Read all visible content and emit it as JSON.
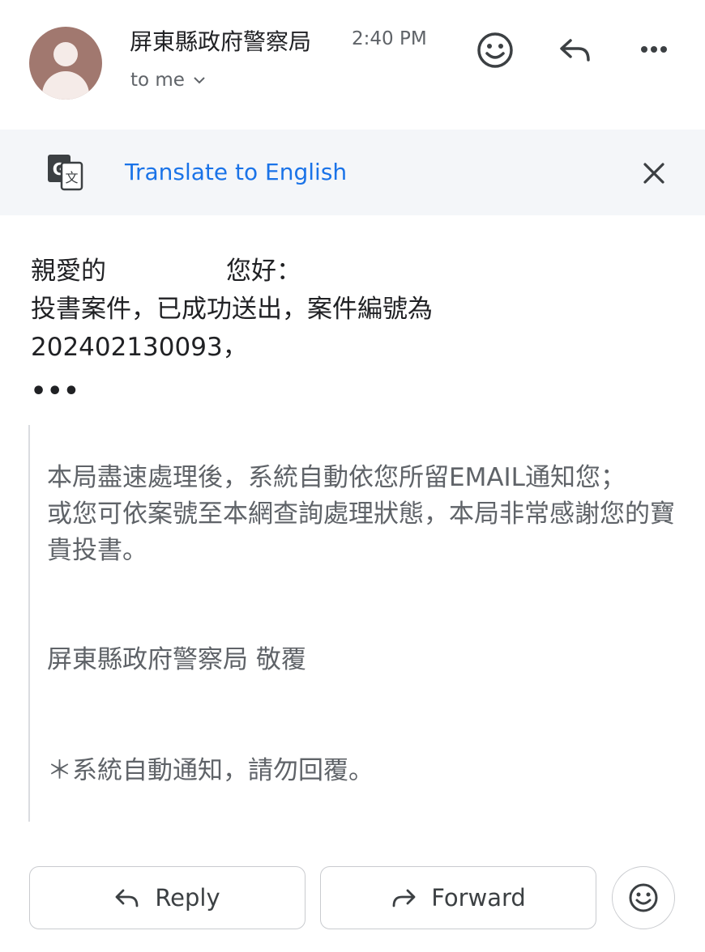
{
  "header": {
    "sender": "屏東縣政府警察局",
    "time": "2:40 PM",
    "recipient": "to me",
    "icons": {
      "avatar": "default-person-avatar",
      "emoji": "add-reaction-icon",
      "reply": "reply-icon",
      "more": "more-options-icon",
      "recipient_expand": "chevron-down-icon"
    }
  },
  "translate_bar": {
    "icon": "google-translate-icon",
    "link_text": "Translate to English",
    "close_icon": "close-icon"
  },
  "message": {
    "greeting_start": "親愛的",
    "greeting_end": "您好：",
    "line2": "投書案件，已成功送出，案件編號為",
    "line3": "202402130093，",
    "collapsed_indicator": "•••"
  },
  "quoted": {
    "para1": "本局盡速處理後，系統自動依您所留EMAIL通知您；",
    "para2": "或您可依案號至本網查詢處理狀態，本局非常感謝您的寶貴投書。",
    "signature": "屏東縣政府警察局 敬覆",
    "notice": "＊系統自動通知，請勿回覆。"
  },
  "actions": {
    "reply_label": "Reply",
    "forward_label": "Forward",
    "emoji_icon": "add-reaction-icon"
  },
  "colors": {
    "link": "#1a73e8",
    "avatar_bg": "#a1786f",
    "translate_bar_bg": "#f4f6f9",
    "quoted_text": "#5f6368"
  }
}
